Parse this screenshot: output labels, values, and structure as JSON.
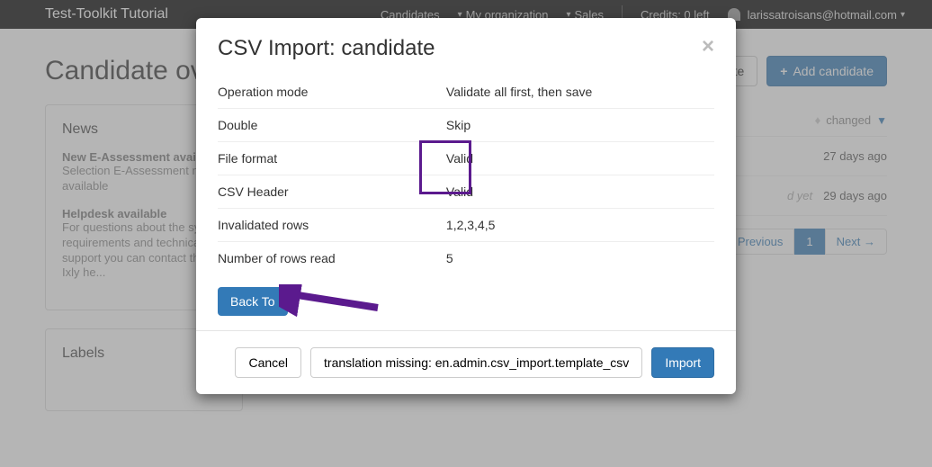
{
  "topbar": {
    "brand": "Test-Toolkit Tutorial",
    "nav": {
      "candidates": "Candidates",
      "org": "My organization",
      "sales": "Sales"
    },
    "credits": "Credits: 0 left",
    "user": "larissatroisans@hotmail.com"
  },
  "page": {
    "title": "Candidate overview",
    "new_btn": "ate",
    "add_btn": "Add candidate"
  },
  "side": {
    "news_title": "News",
    "news": [
      {
        "t": "New E-Assessment available",
        "b": "Selection E-Assessment now available"
      },
      {
        "t": "Helpdesk available",
        "b": "For questions about the system requirements and technical support you can contact the Ixly he..."
      }
    ],
    "labels_title": "Labels"
  },
  "table": {
    "changed_header": "changed",
    "rows": [
      {
        "note": "",
        "changed": "27 days ago"
      },
      {
        "note": "d yet",
        "changed": "29 days ago"
      }
    ]
  },
  "pager": {
    "prev": "← Previous",
    "one": "1",
    "next": "Next →"
  },
  "modal": {
    "title": "CSV Import: candidate",
    "rows": [
      {
        "k": "Operation mode",
        "v": "Validate all first, then save"
      },
      {
        "k": "Double",
        "v": "Skip"
      },
      {
        "k": "File format",
        "v": "Valid"
      },
      {
        "k": "CSV Header",
        "v": "Valid"
      },
      {
        "k": "Invalidated rows",
        "v": "1,2,3,4,5"
      },
      {
        "k": "Number of rows read",
        "v": "5"
      }
    ],
    "back_to": "Back To",
    "cancel": "Cancel",
    "template": "translation missing: en.admin.csv_import.template_csv",
    "import": "Import"
  }
}
